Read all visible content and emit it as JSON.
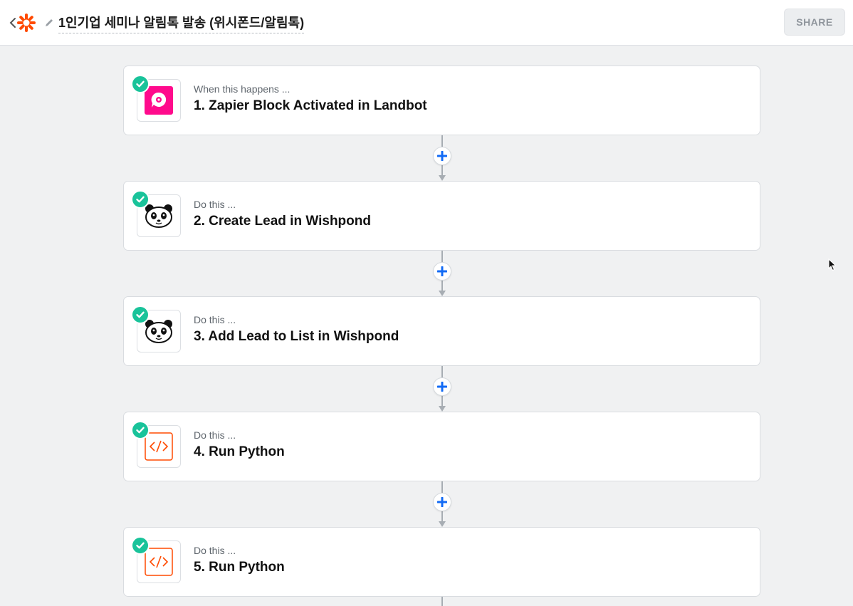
{
  "header": {
    "title": "1인기업 세미나 알림톡 발송 (위시폰드/알림톡)",
    "share_label": "SHARE"
  },
  "colors": {
    "accent_orange": "#ff4a00",
    "check_green": "#19c39a",
    "plus_blue": "#136bf5",
    "landbot_pink": "#ff0a8c"
  },
  "steps": [
    {
      "sub": "When this happens ...",
      "title": "1. Zapier Block Activated in Landbot",
      "icon": "landbot-icon"
    },
    {
      "sub": "Do this ...",
      "title": "2. Create Lead in Wishpond",
      "icon": "wishpond-panda-icon"
    },
    {
      "sub": "Do this ...",
      "title": "3. Add Lead to List in Wishpond",
      "icon": "wishpond-panda-icon"
    },
    {
      "sub": "Do this ...",
      "title": "4. Run Python",
      "icon": "code-icon"
    },
    {
      "sub": "Do this ...",
      "title": "5. Run Python",
      "icon": "code-icon"
    }
  ]
}
